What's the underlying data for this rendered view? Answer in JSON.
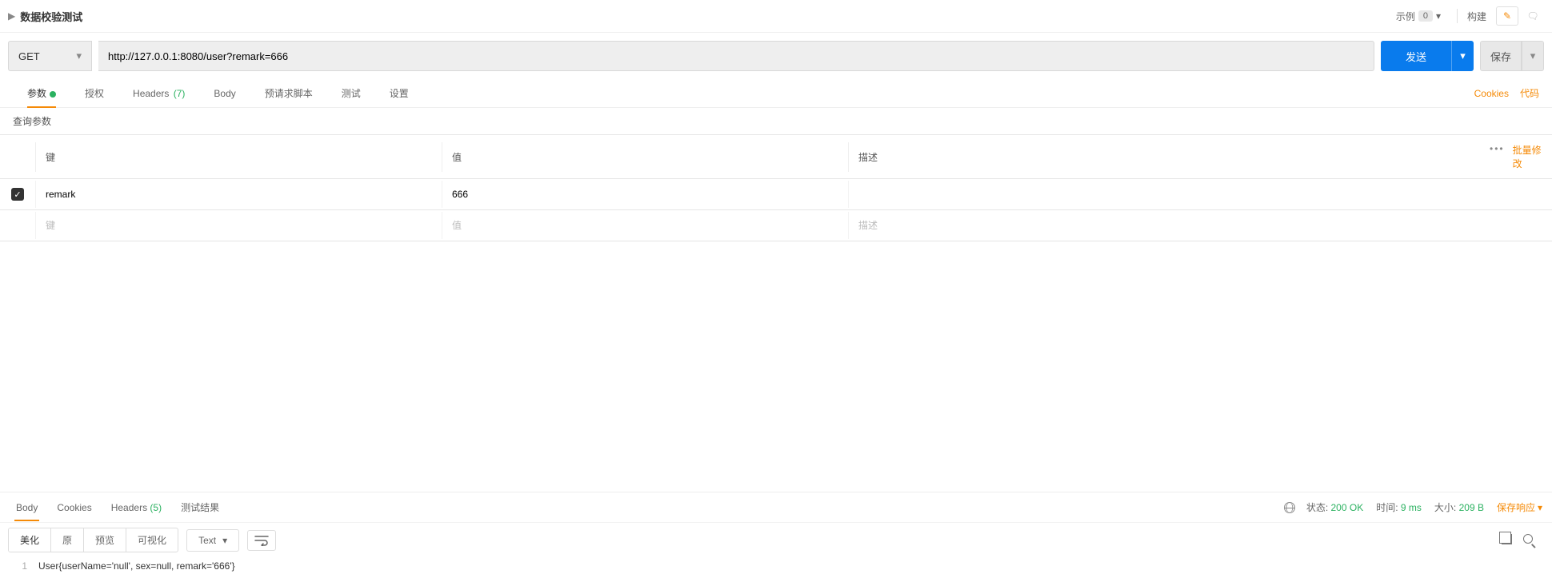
{
  "topbar": {
    "title": "数据校验测试",
    "examples_label": "示例",
    "examples_count": "0",
    "build_label": "构建"
  },
  "request": {
    "method": "GET",
    "url": "http://127.0.0.1:8080/user?remark=666",
    "send_label": "发送",
    "save_label": "保存"
  },
  "req_tabs": {
    "params": "参数",
    "auth": "授权",
    "headers": "Headers",
    "headers_count": "(7)",
    "body": "Body",
    "prereq": "预请求脚本",
    "tests": "测试",
    "settings": "设置",
    "cookies_link": "Cookies",
    "code_link": "代码"
  },
  "params": {
    "subhead": "查询参数",
    "col_key": "键",
    "col_val": "值",
    "col_desc": "描述",
    "bulk": "批量修改",
    "rows": [
      {
        "checked": true,
        "key": "remark",
        "value": "666",
        "desc": ""
      }
    ],
    "ph_key": "键",
    "ph_val": "值",
    "ph_desc": "描述"
  },
  "resp_tabs": {
    "body": "Body",
    "cookies": "Cookies",
    "headers": "Headers",
    "headers_count": "(5)",
    "tests_result": "测试结果"
  },
  "status": {
    "status_lbl": "状态:",
    "status_val": "200 OK",
    "time_lbl": "时间:",
    "time_val": "9 ms",
    "size_lbl": "大小:",
    "size_val": "209 B",
    "save_resp": "保存响应"
  },
  "resp_toolbar": {
    "beautify": "美化",
    "raw": "原",
    "preview": "预览",
    "visualize": "可视化",
    "format": "Text"
  },
  "response_body": "User{userName='null', sex=null, remark='666'}"
}
